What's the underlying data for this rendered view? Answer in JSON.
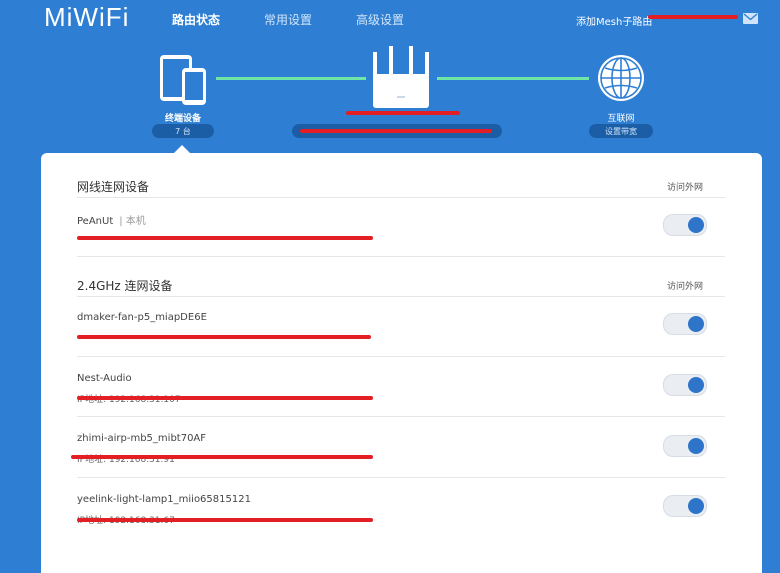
{
  "header": {
    "logo": "MiWiFi",
    "tabs": [
      {
        "label": "路由状态",
        "active": true
      },
      {
        "label": "常用设置",
        "active": false
      },
      {
        "label": "高级设置",
        "active": false
      }
    ],
    "mesh_link": "添加Mesh子路由",
    "icons": {
      "mail": "mail-icon"
    }
  },
  "topology": {
    "devices": {
      "label": "终端设备",
      "count": "7 台"
    },
    "internet": {
      "label": "互联网",
      "settings": "设置带宽"
    },
    "icons": {
      "devices": "devices-icon",
      "router": "router-icon",
      "internet": "globe-icon"
    },
    "link_color": "#6fe6a5"
  },
  "wired": {
    "title": "网线连网设备",
    "column_header": "访问外网",
    "rows": [
      {
        "name": "PeAnUt",
        "tag": "| 本机",
        "enabled": true
      }
    ]
  },
  "wifi24": {
    "title": "2.4GHz 连网设备",
    "column_header": "访问外网",
    "rows": [
      {
        "name": "dmaker-fan-p5_miapDE6E",
        "detail": "",
        "enabled": true
      },
      {
        "name": "Nest-Audio",
        "detail": "IP地址: 192.168.31.107",
        "enabled": true
      },
      {
        "name": "zhimi-airp-mb5_mibt70AF",
        "detail": "IP地址: 192.168.31.91",
        "enabled": true
      },
      {
        "name": "yeelink-light-lamp1_miio65815121",
        "detail": "IP地址: 192.168.31.67",
        "enabled": true
      }
    ]
  },
  "colors": {
    "background": "#2e7fd3",
    "accent": "#2e74c8",
    "redaction": "#e31e24"
  }
}
